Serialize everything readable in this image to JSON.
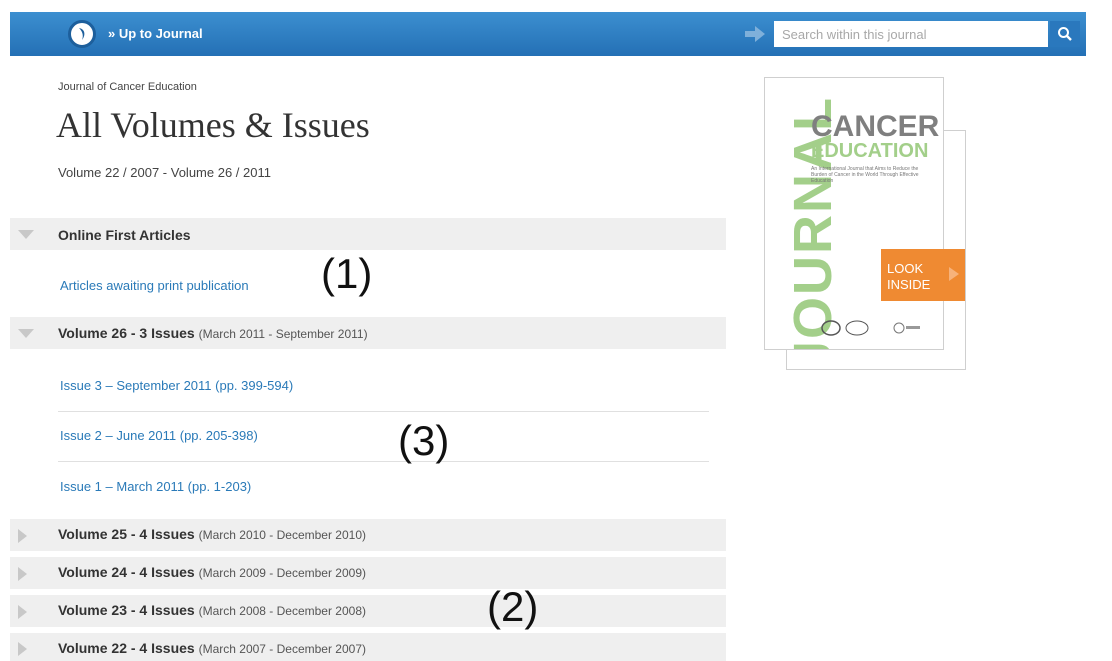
{
  "header": {
    "up_link": "» Up to Journal",
    "search_placeholder": "Search within this journal"
  },
  "journal_name": "Journal of Cancer Education",
  "page_title": "All Volumes & Issues",
  "volume_range": "Volume 22 / 2007 - Volume 26 / 2011",
  "online_first": {
    "title": "Online First Articles",
    "link": "Articles awaiting print publication"
  },
  "volume26": {
    "title": "Volume 26 - 3 Issues",
    "range": "(March 2011 - September 2011)",
    "issues": [
      "Issue 3 – September 2011 (pp. 399-594)",
      "Issue 2 – June 2011 (pp. 205-398)",
      "Issue 1 – March 2011 (pp. 1-203)"
    ]
  },
  "collapsed_volumes": [
    {
      "title": "Volume 25 - 4 Issues",
      "range": "(March 2010 - December 2010)"
    },
    {
      "title": "Volume 24 - 4 Issues",
      "range": "(March 2009 - December 2009)"
    },
    {
      "title": "Volume 23 - 4 Issues",
      "range": "(March 2008 - December 2008)"
    },
    {
      "title": "Volume 22 - 4 Issues",
      "range": "(March 2007 - December 2007)"
    }
  ],
  "annotations": [
    "(1)",
    "(3)",
    "(2)"
  ],
  "cover": {
    "journal": "JOURNAL",
    "cancer": "CANCER",
    "education": "EDUCATION",
    "subtitle": "An International Journal that Aims to Reduce the Burden of Cancer in the World Through Effective Education",
    "look_inside": "LOOK INSIDE"
  },
  "colors": {
    "topbar": "#2470b5",
    "link": "#2a7ab8",
    "look_inside": "#ef8a32",
    "cover_green": "#a3cf8a"
  }
}
